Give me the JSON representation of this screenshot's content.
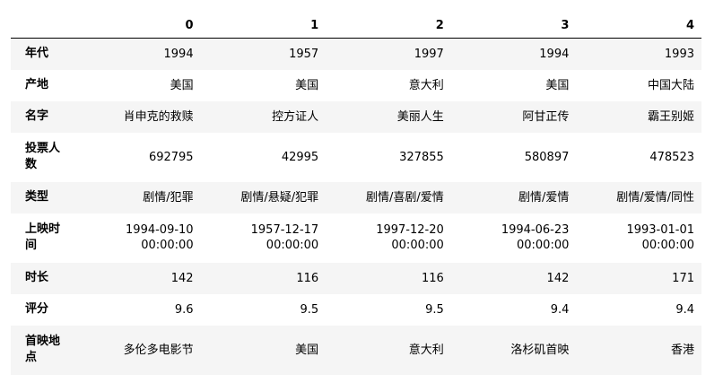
{
  "table": {
    "columns": [
      "",
      "0",
      "1",
      "2",
      "3",
      "4"
    ],
    "rows": [
      {
        "index": "年代",
        "cells": [
          "1994",
          "1957",
          "1997",
          "1994",
          "1993"
        ]
      },
      {
        "index": "产地",
        "cells": [
          "美国",
          "美国",
          "意大利",
          "美国",
          "中国大陆"
        ]
      },
      {
        "index": "名字",
        "cells": [
          "肖申克的救赎",
          "控方证人",
          "美丽人生",
          "阿甘正传",
          "霸王别姬"
        ]
      },
      {
        "index": "投票人数",
        "cells": [
          "692795",
          "42995",
          "327855",
          "580897",
          "478523"
        ]
      },
      {
        "index": "类型",
        "cells": [
          "剧情/犯罪",
          "剧情/悬疑/犯罪",
          "剧情/喜剧/爱情",
          "剧情/爱情",
          "剧情/爱情/同性"
        ]
      },
      {
        "index": "上映时间",
        "cells": [
          {
            "date": "1994-09-10",
            "time": "00:00:00"
          },
          {
            "date": "1957-12-17",
            "time": "00:00:00"
          },
          {
            "date": "1997-12-20",
            "time": "00:00:00"
          },
          {
            "date": "1994-06-23",
            "time": "00:00:00"
          },
          {
            "date": "1993-01-01",
            "time": "00:00:00"
          }
        ]
      },
      {
        "index": "时长",
        "cells": [
          "142",
          "116",
          "116",
          "142",
          "171"
        ]
      },
      {
        "index": "评分",
        "cells": [
          "9.6",
          "9.5",
          "9.5",
          "9.4",
          "9.4"
        ]
      },
      {
        "index": "首映地点",
        "cells": [
          "多伦多电影节",
          "美国",
          "意大利",
          "洛杉矶首映",
          "香港"
        ]
      }
    ]
  }
}
